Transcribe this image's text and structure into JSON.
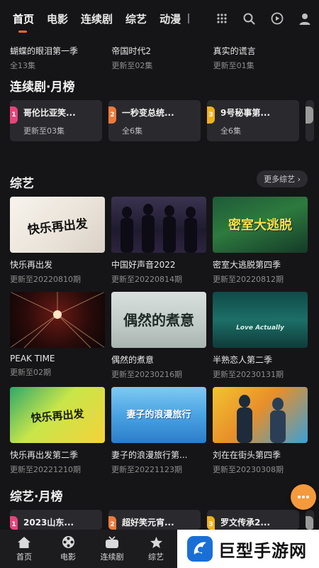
{
  "nav": {
    "tabs": [
      "首页",
      "电影",
      "连续剧",
      "综艺",
      "动漫"
    ]
  },
  "top_row": [
    {
      "title": "蝴蝶的眼泪第一季",
      "sub": "全13集"
    },
    {
      "title": "帝国时代2",
      "sub": "更新至02集"
    },
    {
      "title": "真实的谎言",
      "sub": "更新至01集"
    }
  ],
  "series_rank": {
    "title": "连续剧·月榜",
    "items": [
      {
        "rank": "1",
        "title": "哥伦比亚笑...",
        "sub": "更新至03集"
      },
      {
        "rank": "2",
        "title": "一秒变总统...",
        "sub": "全6集"
      },
      {
        "rank": "3",
        "title": "9号秘事第...",
        "sub": "全6集"
      }
    ]
  },
  "variety": {
    "title": "综艺",
    "more": "更多综艺 ›",
    "items": [
      {
        "title": "快乐再出发",
        "sub": "更新至20220810期",
        "art": "快乐再出发"
      },
      {
        "title": "中国好声音2022",
        "sub": "更新至20220814期",
        "art": ""
      },
      {
        "title": "密室大逃脱第四季",
        "sub": "更新至20220812期",
        "art": "密室大逃脱"
      },
      {
        "title": "PEAK TIME",
        "sub": "更新至02期",
        "art": ""
      },
      {
        "title": "偶然的煮意",
        "sub": "更新至20230216期",
        "art": "偶然的煮意"
      },
      {
        "title": "半熟恋人第二季",
        "sub": "更新至20230131期",
        "art": "Love Actually"
      },
      {
        "title": "快乐再出发第二季",
        "sub": "更新至20221210期",
        "art": "快乐再出发"
      },
      {
        "title": "妻子的浪漫旅行第...",
        "sub": "更新至20221123期",
        "art": "妻子的浪漫旅行"
      },
      {
        "title": "刘在在街头第四季",
        "sub": "更新至20230308期",
        "art": ""
      }
    ]
  },
  "variety_rank": {
    "title": "综艺·月榜",
    "items": [
      {
        "rank": "1",
        "title": "2023山东..."
      },
      {
        "rank": "2",
        "title": "超好笑元宵..."
      },
      {
        "rank": "3",
        "title": "罗文传承2..."
      }
    ]
  },
  "bottom_nav": [
    {
      "label": "首页",
      "icon": "home-icon"
    },
    {
      "label": "电影",
      "icon": "film-reel-icon"
    },
    {
      "label": "连续剧",
      "icon": "tv-icon"
    },
    {
      "label": "综艺",
      "icon": "star-icon"
    }
  ],
  "watermark": {
    "text": "巨型手游网"
  },
  "colors": {
    "accent": "#ff6a2c",
    "fab": "#f59a3c"
  }
}
